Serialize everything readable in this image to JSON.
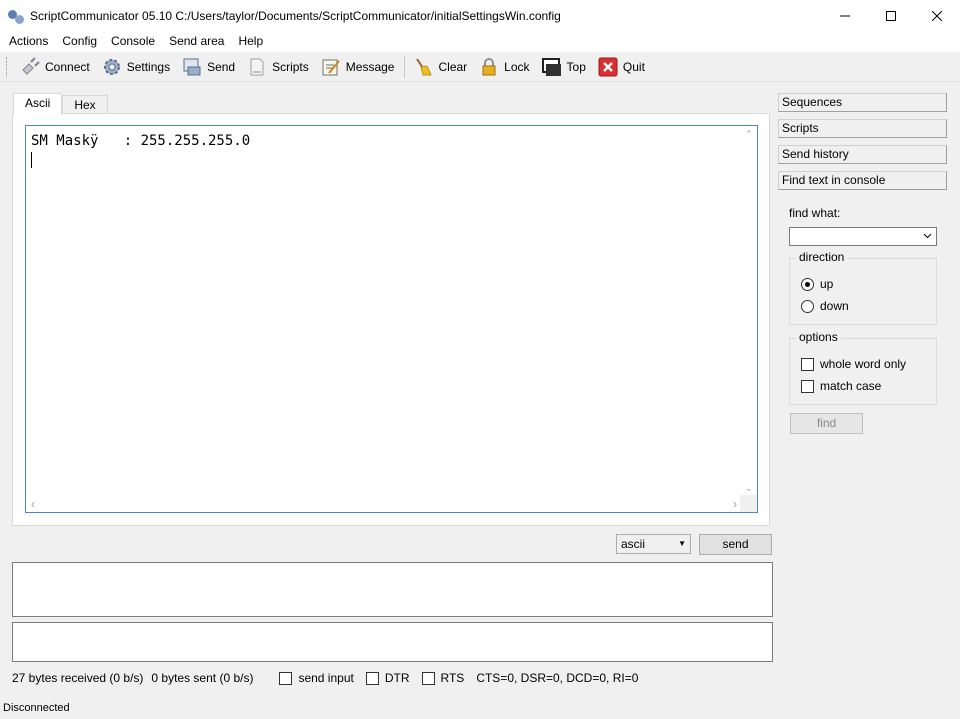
{
  "window": {
    "title": "ScriptCommunicator 05.10  C:/Users/taylor/Documents/ScriptCommunicator/initialSettingsWin.config",
    "minimize_icon": "minimize-icon",
    "maximize_icon": "maximize-icon",
    "close_icon": "close-icon"
  },
  "menu": [
    "Actions",
    "Config",
    "Console",
    "Send area",
    "Help"
  ],
  "toolbar": {
    "connect": "Connect",
    "settings": "Settings",
    "send": "Send",
    "scripts": "Scripts",
    "message": "Message",
    "clear": "Clear",
    "lock": "Lock",
    "top": "Top",
    "quit": "Quit"
  },
  "tabs": [
    "Ascii",
    "Hex"
  ],
  "console": {
    "text": "SM Maskÿ   : 255.255.255.0"
  },
  "send_row": {
    "format": "ascii",
    "send_label": "send"
  },
  "status_line": {
    "received": "27 bytes received (0 b/s)",
    "sent": "0 bytes sent (0 b/s)",
    "send_input": "send input",
    "dtr": "DTR",
    "rts": "RTS",
    "signals": "CTS=0, DSR=0, DCD=0, RI=0"
  },
  "status_bar": "Disconnected",
  "right_panel": {
    "buttons": [
      "Sequences",
      "Scripts",
      "Send history",
      "Find text in console"
    ],
    "find_what": "find what:",
    "direction": {
      "title": "direction",
      "up": "up",
      "down": "down",
      "selected": "up"
    },
    "options": {
      "title": "options",
      "whole_word": "whole word only",
      "match_case": "match case"
    },
    "find_label": "find"
  }
}
